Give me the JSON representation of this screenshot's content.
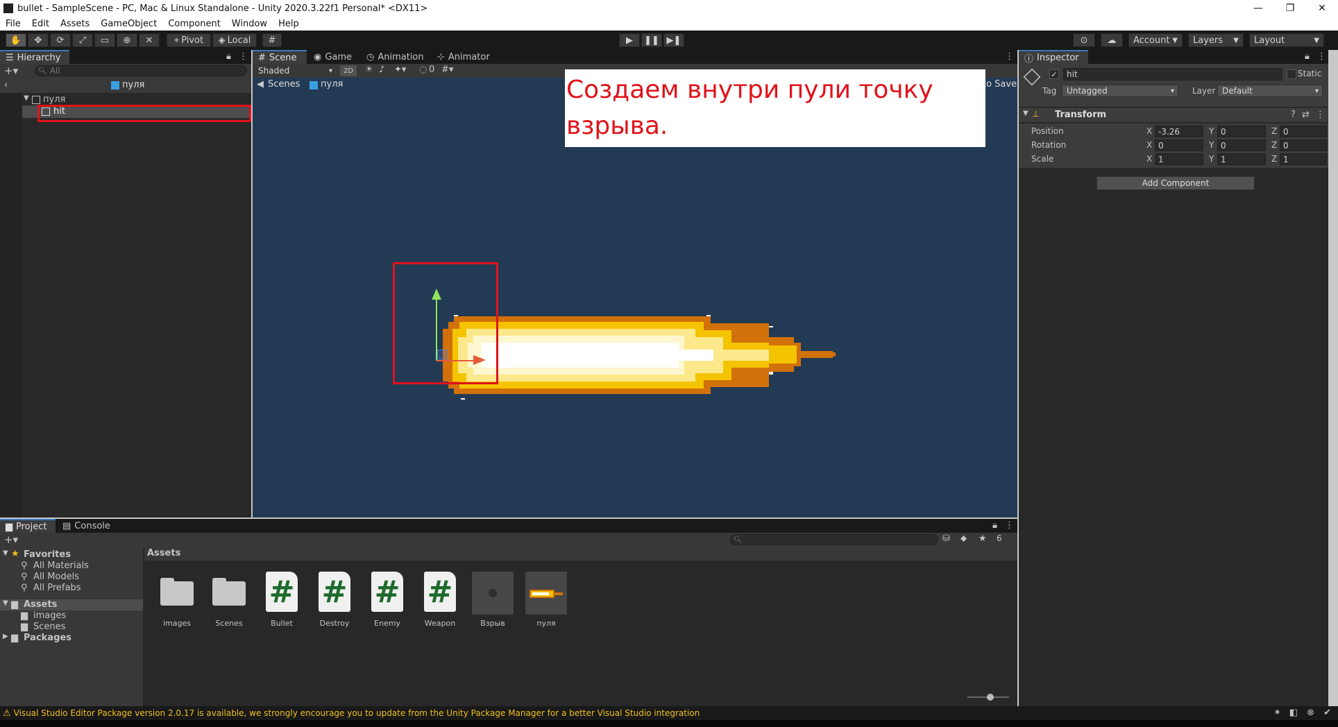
{
  "window": {
    "title": "bullet - SampleScene - PC, Mac & Linux Standalone - Unity 2020.3.22f1 Personal* <DX11>",
    "minimize": "—",
    "restore": "❐",
    "close": "✕"
  },
  "menu": [
    "File",
    "Edit",
    "Assets",
    "GameObject",
    "Component",
    "Window",
    "Help"
  ],
  "toolbar": {
    "pivot": "Pivot",
    "local": "Local",
    "account": "Account",
    "layers": "Layers",
    "layout": "Layout"
  },
  "hierarchy": {
    "tab": "Hierarchy",
    "search_placeholder": "All",
    "breadcrumb": "пуля",
    "root": "пуля",
    "child": "hit"
  },
  "scene": {
    "tabs": [
      "Scene",
      "Game",
      "Animation",
      "Animator"
    ],
    "shading": "Shaded",
    "mode_2d": "2D",
    "fx_count": "0",
    "breadcrumb_scenes": "Scenes",
    "breadcrumb_prefab": "пуля",
    "autosave": "to Save"
  },
  "annotation": {
    "text": "Создаем внутри пули точку взрыва."
  },
  "inspector": {
    "tab": "Inspector",
    "object_name": "hit",
    "static_label": "Static",
    "tag_label": "Tag",
    "tag_value": "Untagged",
    "layer_label": "Layer",
    "layer_value": "Default",
    "component": "Transform",
    "rows": [
      {
        "label": "Position",
        "x": "-3.26",
        "y": "0",
        "z": "0"
      },
      {
        "label": "Rotation",
        "x": "0",
        "y": "0",
        "z": "0"
      },
      {
        "label": "Scale",
        "x": "1",
        "y": "1",
        "z": "1"
      }
    ],
    "add_component": "Add Component"
  },
  "project": {
    "tabs": [
      "Project",
      "Console"
    ],
    "hidden_count": "6",
    "favorites": "Favorites",
    "favorite_items": [
      "All Materials",
      "All Models",
      "All Prefabs"
    ],
    "assets_root": "Assets",
    "asset_folders": [
      "images",
      "Scenes"
    ],
    "packages": "Packages",
    "header": "Assets",
    "items": [
      {
        "name": "images",
        "kind": "folder"
      },
      {
        "name": "Scenes",
        "kind": "folder"
      },
      {
        "name": "Bullet",
        "kind": "script"
      },
      {
        "name": "Destroy",
        "kind": "script"
      },
      {
        "name": "Enemy",
        "kind": "script"
      },
      {
        "name": "Weapon",
        "kind": "script"
      },
      {
        "name": "Взрыв",
        "kind": "prefab"
      },
      {
        "name": "пуля",
        "kind": "sprite"
      }
    ]
  },
  "status": {
    "warning": "Visual Studio Editor Package version 2.0.17 is available, we strongly encourage you to update from the Unity Package Manager for a better Visual Studio integration"
  },
  "colors": {
    "scene_bg": "#233a54",
    "accent_red": "#e0121a",
    "selection": "#4d4d4d"
  }
}
